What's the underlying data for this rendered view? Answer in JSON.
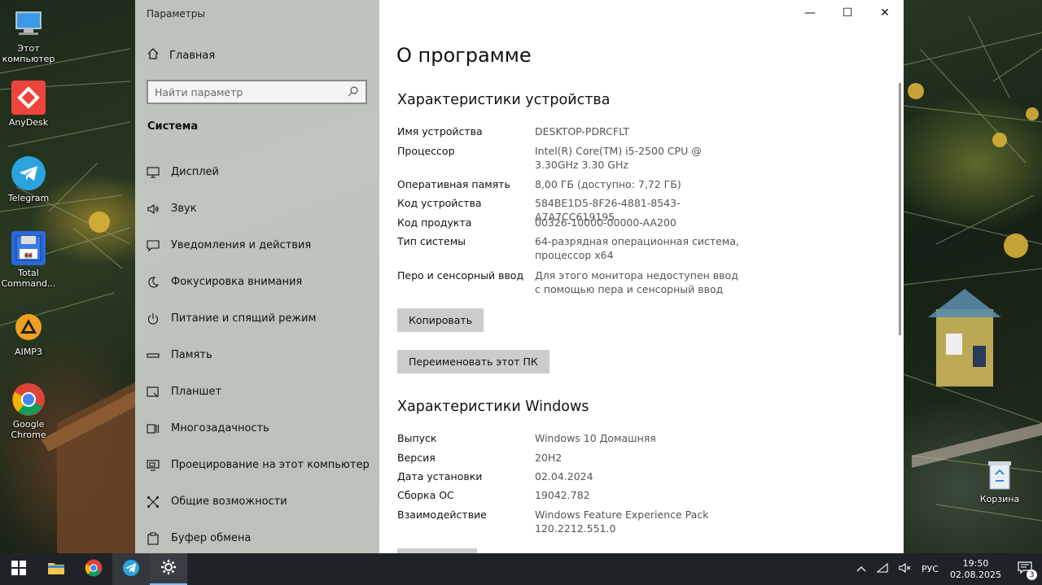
{
  "desktop": {
    "icons": [
      {
        "label": "Этот компьютер"
      },
      {
        "label": "AnyDesk"
      },
      {
        "label": "Telegram"
      },
      {
        "label": "Total Command..."
      },
      {
        "label": "AIMP3"
      },
      {
        "label": "Google Chrome"
      },
      {
        "label": "Корзина"
      }
    ]
  },
  "window": {
    "title": "Параметры",
    "controls": {
      "minimize": "—",
      "maximize": "☐",
      "close": "✕"
    }
  },
  "sidebar": {
    "home": "Главная",
    "search_placeholder": "Найти параметр",
    "section": "Система",
    "items": [
      {
        "label": "Дисплей",
        "icon": "monitor-icon"
      },
      {
        "label": "Звук",
        "icon": "speaker-icon"
      },
      {
        "label": "Уведомления и действия",
        "icon": "notification-icon"
      },
      {
        "label": "Фокусировка внимания",
        "icon": "moon-icon"
      },
      {
        "label": "Питание и спящий режим",
        "icon": "power-icon"
      },
      {
        "label": "Память",
        "icon": "storage-icon"
      },
      {
        "label": "Планшет",
        "icon": "tablet-icon"
      },
      {
        "label": "Многозадачность",
        "icon": "multitask-icon"
      },
      {
        "label": "Проецирование на этот компьютер",
        "icon": "project-icon"
      },
      {
        "label": "Общие возможности",
        "icon": "shared-icon"
      },
      {
        "label": "Буфер обмена",
        "icon": "clipboard-icon"
      }
    ]
  },
  "content": {
    "title": "О программе",
    "device_heading": "Характеристики устройства",
    "device_specs": [
      {
        "key": "Имя устройства",
        "value": "DESKTOP-PDRCFLT"
      },
      {
        "key": "Процессор",
        "value": "Intel(R) Core(TM) i5-2500 CPU @ 3.30GHz 3.30 GHz"
      },
      {
        "key": "Оперативная память",
        "value": "8,00 ГБ (доступно: 7,72 ГБ)"
      },
      {
        "key": "Код устройства",
        "value": "584BE1D5-8F26-4881-8543-A7A7CC619195"
      },
      {
        "key": "Код продукта",
        "value": "00326-10000-00000-AA200"
      },
      {
        "key": "Тип системы",
        "value": "64-разрядная операционная система, процессор x64"
      },
      {
        "key": "Перо и сенсорный ввод",
        "value": "Для этого монитора недоступен ввод с помощью пера и сенсорный ввод"
      }
    ],
    "copy_button": "Копировать",
    "rename_button": "Переименовать этот ПК",
    "windows_heading": "Характеристики Windows",
    "windows_specs": [
      {
        "key": "Выпуск",
        "value": "Windows 10 Домашняя"
      },
      {
        "key": "Версия",
        "value": "20H2"
      },
      {
        "key": "Дата установки",
        "value": "02.04.2024"
      },
      {
        "key": "Сборка ОС",
        "value": "19042.782"
      },
      {
        "key": "Взаимодействие",
        "value": "Windows Feature Experience Pack 120.2212.551.0"
      }
    ]
  },
  "taskbar": {
    "language": "РУС",
    "time": "19:50",
    "date": "02.08.2025",
    "notifications_count": "3"
  }
}
